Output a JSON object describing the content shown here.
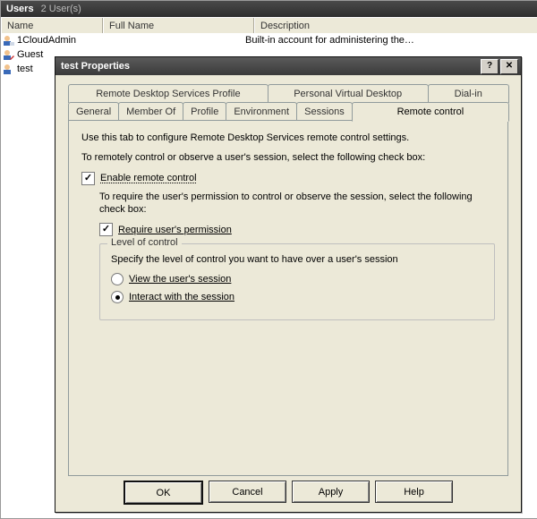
{
  "header": {
    "title": "Users",
    "count": "2 User(s)"
  },
  "columns": {
    "name": "Name",
    "fullname": "Full Name",
    "description": "Description"
  },
  "users": [
    {
      "name": "1CloudAdmin",
      "fullname": "",
      "description": "Built-in account for administering the…"
    },
    {
      "name": "Guest",
      "fullname": "",
      "description": ""
    },
    {
      "name": "test",
      "fullname": "",
      "description": ""
    }
  ],
  "dialog": {
    "title": "test Properties",
    "tabs": {
      "back": [
        "Remote Desktop Services Profile",
        "Personal Virtual Desktop",
        "Dial-in"
      ],
      "front": [
        "General",
        "Member Of",
        "Profile",
        "Environment",
        "Sessions",
        "Remote control"
      ]
    },
    "panel": {
      "intro": "Use this tab to configure Remote Desktop Services remote control settings.",
      "para1": "To remotely control or observe a user's session, select the following check box:",
      "enable": "Enable remote control",
      "para2": "To require the user's permission to control or observe the session, select the following check box:",
      "require": "Require user's permission",
      "groupTitle": "Level of control",
      "groupIntro": "Specify the level of control you want to have over a user's session",
      "view": "View the user's session",
      "interact": "Interact with the session"
    },
    "buttons": {
      "ok": "OK",
      "cancel": "Cancel",
      "apply": "Apply",
      "help": "Help"
    }
  }
}
